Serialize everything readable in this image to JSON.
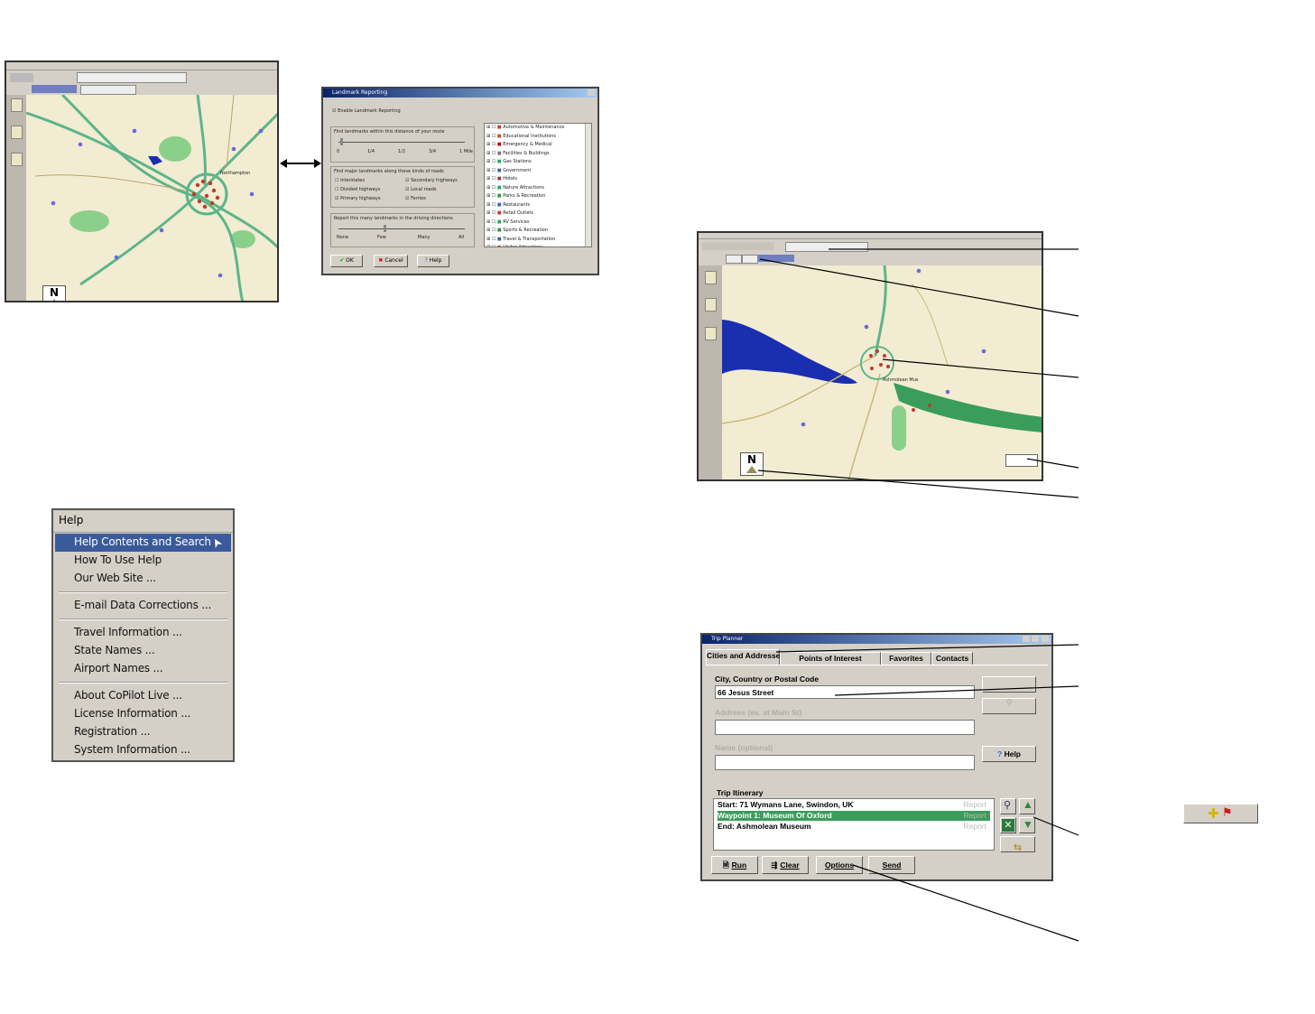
{
  "landmark_dialog": {
    "title": "Landmark Reporting",
    "enable_label": "Enable Landmark Reporting",
    "distance_label": "Find landmarks within this distance of your route",
    "distance_ticks": [
      "0",
      "1/4",
      "1/2",
      "3/4",
      "1 Mile"
    ],
    "road_types_label": "Find major landmarks along these kinds of roads",
    "road_types": [
      {
        "label": "Interstates",
        "checked": false
      },
      {
        "label": "Secondary highways",
        "checked": true
      },
      {
        "label": "Divided highways",
        "checked": false
      },
      {
        "label": "Local roads",
        "checked": true
      },
      {
        "label": "Primary highways",
        "checked": true
      },
      {
        "label": "Ferries",
        "checked": true
      }
    ],
    "report_label": "Report this many landmarks in the driving directions",
    "report_ticks": [
      "None",
      "Few",
      "Many",
      "All"
    ],
    "categories": [
      "Automotive & Maintenance",
      "Educational Institutions",
      "Emergency & Medical",
      "Facilities & Buildings",
      "Gas Stations",
      "Government",
      "Hotels",
      "Nature Attractions",
      "Parks & Recreation",
      "Restaurants",
      "Retail Outlets",
      "RV Services",
      "Sports & Recreation",
      "Travel & Transportation",
      "Visitor Attractions"
    ],
    "ok_label": "OK",
    "cancel_label": "Cancel",
    "help_label": "Help"
  },
  "help_menu": {
    "title": "Help",
    "groups": [
      [
        "Help Contents and Search",
        "How To Use Help",
        "Our Web Site ..."
      ],
      [
        "E-mail Data Corrections ..."
      ],
      [
        "Travel Information ...",
        "State Names ...",
        "Airport Names ..."
      ],
      [
        "About CoPilot Live ...",
        "License Information ...",
        "Registration ...",
        "System Information ..."
      ]
    ],
    "selected": "Help Contents and Search"
  },
  "maps": {
    "compass_letter": "N",
    "label_town": "Northampton",
    "label_oxford": "Ashmolean Mus"
  },
  "trip_planner": {
    "title": "Trip Planner",
    "tabs": [
      "Cities and Addresses",
      "Points of Interest",
      "Favorites",
      "Contacts"
    ],
    "city_label": "City, Country or Postal Code",
    "city_value": "66 Jesus Street",
    "address_label": "Address (ex. at Main St)",
    "name_label": "Name (optional)",
    "help_label": "Help",
    "itinerary_label": "Trip Itinerary",
    "itinerary": [
      {
        "text": "Start: 71 Wymans Lane, Swindon, UK",
        "right": "Report",
        "selected": false
      },
      {
        "text": "Waypoint 1: Museum Of Oxford",
        "right": "Report",
        "selected": true
      },
      {
        "text": "End: Ashmolean Museum",
        "right": "Report",
        "selected": false
      }
    ],
    "buttons": [
      "Run",
      "Clear",
      "Options",
      "Send"
    ]
  },
  "colors": {
    "map_bg": "#f2ecd2",
    "road": "#5db58a",
    "water": "#1a2fb0",
    "park": "#8ad08a",
    "poi": "#6b6bd6",
    "landmark": "#c0392b",
    "menu_highlight": "#3a5a9c",
    "itinerary_highlight": "#3a9d5a"
  }
}
